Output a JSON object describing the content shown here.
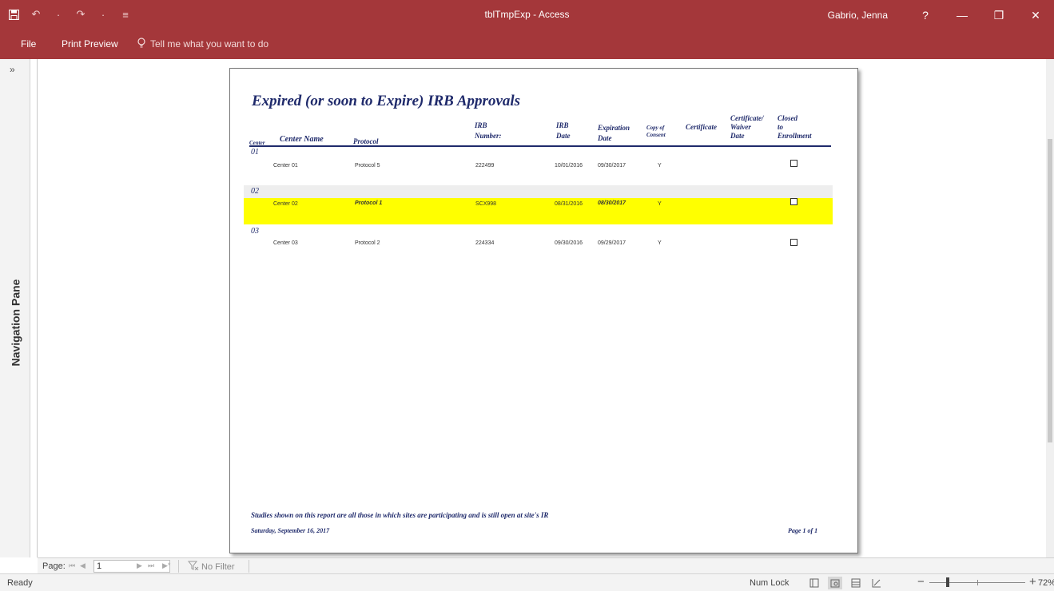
{
  "window": {
    "title": "tblTmpExp  -  Access",
    "user": "Gabrio, Jenna",
    "help": "?",
    "minimize": "—",
    "restore": "❐",
    "close": "✕"
  },
  "qat": {
    "undo": "↶",
    "undo_menu": "·",
    "redo": "↷",
    "redo_menu": "·",
    "customize": "≡"
  },
  "ribbon": {
    "tab_file": "File",
    "tab_print_preview": "Print Preview",
    "tell_me": "Tell me what you want to do"
  },
  "nav_pane": {
    "toggle": "»",
    "label": "Navigation Pane"
  },
  "report": {
    "title": "Expired (or soon to Expire) IRB Approvals",
    "headers": {
      "center": "Center",
      "center_name": "Center Name",
      "protocol": "Protocol",
      "irb_number_1": "IRB",
      "irb_number_2": "Number:",
      "irb_date_1": "IRB",
      "irb_date_2": "Date",
      "expiration_1": "Expiration",
      "expiration_2": "Date",
      "copy_1": "Copy of",
      "copy_2": "Consent",
      "certificate": "Certificate",
      "cw_1": "Certificate/",
      "cw_2": "Waiver",
      "cw_3": "Date",
      "closed_1": "Closed",
      "closed_2": "to",
      "closed_3": "Enrollment"
    },
    "groups": [
      {
        "center": "01",
        "center_name": "Center 01",
        "protocol": "Protocol 5",
        "irb_number": "222499",
        "irb_date": "10/01/2016",
        "expiration_date": "09/30/2017",
        "copy_of_consent": "Y",
        "closed_to_enrollment": false
      },
      {
        "center": "02",
        "center_name": "Center 02",
        "protocol": "Protocol 1",
        "irb_number": "SCX998",
        "irb_date": "08/31/2016",
        "expiration_date": "08/30/2017",
        "copy_of_consent": "Y",
        "closed_to_enrollment": false
      },
      {
        "center": "03",
        "center_name": "Center 03",
        "protocol": "Protocol 2",
        "irb_number": "224334",
        "irb_date": "09/30/2016",
        "expiration_date": "09/29/2017",
        "copy_of_consent": "Y",
        "closed_to_enrollment": false
      }
    ],
    "highlight_color": "#ffff00",
    "footer_note": "Studies shown on this report are all those in which sites are participating and is still open at site's IR",
    "footer_date": "Saturday, September 16, 2017",
    "footer_page": "Page 1 of 1"
  },
  "record_nav": {
    "label": "Page:",
    "first": "⏮",
    "prev": "◀",
    "value": "1",
    "next": "▶",
    "last": "⏭",
    "new": "▶*",
    "filter": "No Filter"
  },
  "status": {
    "ready": "Ready",
    "num_lock": "Num Lock",
    "zoom_minus": "−",
    "zoom_plus": "+",
    "zoom": "72%"
  },
  "colors": {
    "titlebar": "#a4373a",
    "report_text": "#1f2a6b"
  }
}
